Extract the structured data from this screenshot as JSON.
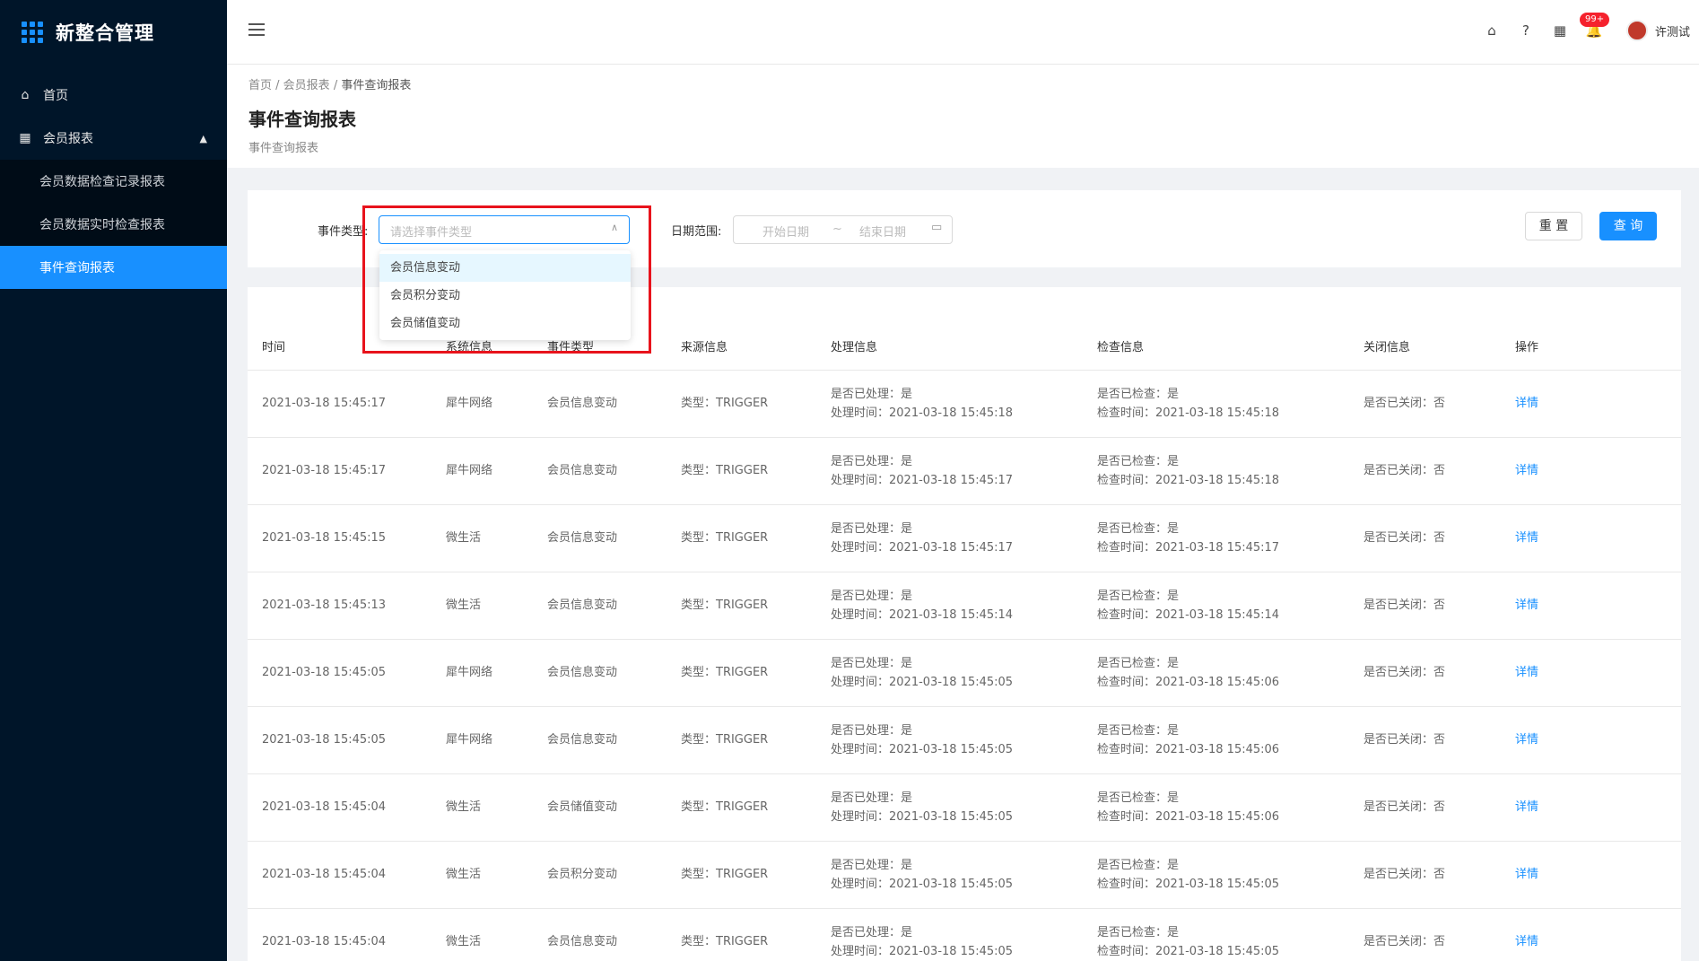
{
  "app": {
    "title": "新整合管理"
  },
  "sidebar": {
    "items": [
      {
        "icon": "home-icon",
        "label": "首页"
      },
      {
        "icon": "table-icon",
        "label": "会员报表"
      }
    ],
    "submenu": [
      {
        "label": "会员数据检查记录报表",
        "active": false
      },
      {
        "label": "会员数据实时检查报表",
        "active": false
      },
      {
        "label": "事件查询报表",
        "active": true
      }
    ]
  },
  "header": {
    "badge": "99+",
    "user": "许测试"
  },
  "breadcrumb": [
    "首页",
    "会员报表",
    "事件查询报表"
  ],
  "page": {
    "title": "事件查询报表",
    "subtitle": "事件查询报表"
  },
  "filter": {
    "event_type_label": "事件类型:",
    "event_type_placeholder": "请选择事件类型",
    "date_label": "日期范围:",
    "start_placeholder": "开始日期",
    "separator": "~",
    "end_placeholder": "结束日期",
    "reset_label": "重 置",
    "query_label": "查 询",
    "options": [
      "会员信息变动",
      "会员积分变动",
      "会员储值变动"
    ]
  },
  "table": {
    "columns": [
      "时间",
      "系统信息",
      "事件类型",
      "来源信息",
      "处理信息",
      "检查信息",
      "关闭信息",
      "操作"
    ],
    "rows": [
      {
        "time": "2021-03-18 15:45:17",
        "system": "犀牛网络",
        "event": "会员信息变动",
        "source": "类型：TRIGGER",
        "proc1": "是否已处理：是",
        "proc2": "处理时间：2021-03-18 15:45:18",
        "chk1": "是否已检查：是",
        "chk2": "检查时间：2021-03-18 15:45:18",
        "close": "是否已关闭：否",
        "action": "详情"
      },
      {
        "time": "2021-03-18 15:45:17",
        "system": "犀牛网络",
        "event": "会员信息变动",
        "source": "类型：TRIGGER",
        "proc1": "是否已处理：是",
        "proc2": "处理时间：2021-03-18 15:45:17",
        "chk1": "是否已检查：是",
        "chk2": "检查时间：2021-03-18 15:45:18",
        "close": "是否已关闭：否",
        "action": "详情"
      },
      {
        "time": "2021-03-18 15:45:15",
        "system": "微生活",
        "event": "会员信息变动",
        "source": "类型：TRIGGER",
        "proc1": "是否已处理：是",
        "proc2": "处理时间：2021-03-18 15:45:17",
        "chk1": "是否已检查：是",
        "chk2": "检查时间：2021-03-18 15:45:17",
        "close": "是否已关闭：否",
        "action": "详情"
      },
      {
        "time": "2021-03-18 15:45:13",
        "system": "微生活",
        "event": "会员信息变动",
        "source": "类型：TRIGGER",
        "proc1": "是否已处理：是",
        "proc2": "处理时间：2021-03-18 15:45:14",
        "chk1": "是否已检查：是",
        "chk2": "检查时间：2021-03-18 15:45:14",
        "close": "是否已关闭：否",
        "action": "详情"
      },
      {
        "time": "2021-03-18 15:45:05",
        "system": "犀牛网络",
        "event": "会员信息变动",
        "source": "类型：TRIGGER",
        "proc1": "是否已处理：是",
        "proc2": "处理时间：2021-03-18 15:45:05",
        "chk1": "是否已检查：是",
        "chk2": "检查时间：2021-03-18 15:45:06",
        "close": "是否已关闭：否",
        "action": "详情"
      },
      {
        "time": "2021-03-18 15:45:05",
        "system": "犀牛网络",
        "event": "会员信息变动",
        "source": "类型：TRIGGER",
        "proc1": "是否已处理：是",
        "proc2": "处理时间：2021-03-18 15:45:05",
        "chk1": "是否已检查：是",
        "chk2": "检查时间：2021-03-18 15:45:06",
        "close": "是否已关闭：否",
        "action": "详情"
      },
      {
        "time": "2021-03-18 15:45:04",
        "system": "微生活",
        "event": "会员储值变动",
        "source": "类型：TRIGGER",
        "proc1": "是否已处理：是",
        "proc2": "处理时间：2021-03-18 15:45:05",
        "chk1": "是否已检查：是",
        "chk2": "检查时间：2021-03-18 15:45:06",
        "close": "是否已关闭：否",
        "action": "详情"
      },
      {
        "time": "2021-03-18 15:45:04",
        "system": "微生活",
        "event": "会员积分变动",
        "source": "类型：TRIGGER",
        "proc1": "是否已处理：是",
        "proc2": "处理时间：2021-03-18 15:45:05",
        "chk1": "是否已检查：是",
        "chk2": "检查时间：2021-03-18 15:45:05",
        "close": "是否已关闭：否",
        "action": "详情"
      },
      {
        "time": "2021-03-18 15:45:04",
        "system": "微生活",
        "event": "会员信息变动",
        "source": "类型：TRIGGER",
        "proc1": "是否已处理：是",
        "proc2": "处理时间：2021-03-18 15:45:05",
        "chk1": "是否已检查：是",
        "chk2": "检查时间：2021-03-18 15:45:05",
        "close": "是否已关闭：否",
        "action": "详情"
      }
    ]
  },
  "colors": {
    "sidebar_bg": "#001529",
    "accent": "#1890ff",
    "highlight_box": "#e8131c"
  }
}
